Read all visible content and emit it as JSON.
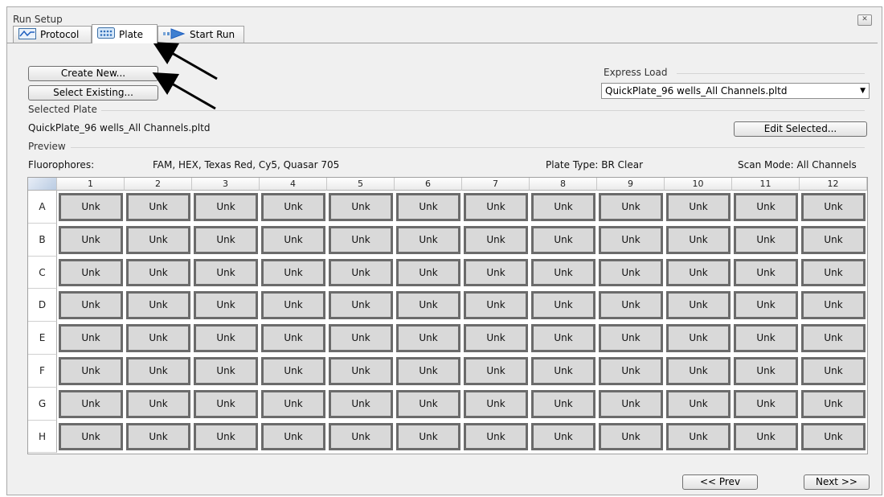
{
  "window": {
    "title": "Run Setup",
    "close_glyph": "✕"
  },
  "tabs": [
    {
      "label": "Protocol",
      "icon": "protocol-graph-icon"
    },
    {
      "label": "Plate",
      "icon": "plate-grid-icon"
    },
    {
      "label": "Start Run",
      "icon": "start-run-arrow-icon"
    }
  ],
  "buttons": {
    "create_new": "Create New...",
    "select_existing": "Select Existing...",
    "edit_selected": "Edit Selected...",
    "prev": "<< Prev",
    "next": "Next >>"
  },
  "express_load": {
    "label": "Express Load",
    "value": "QuickPlate_96 wells_All Channels.pltd"
  },
  "selected_plate": {
    "label": "Selected Plate",
    "file": "QuickPlate_96 wells_All Channels.pltd"
  },
  "preview": {
    "label": "Preview",
    "fluorophores_label": "Fluorophores:",
    "fluorophores_value": "FAM, HEX, Texas Red, Cy5, Quasar 705",
    "plate_type": "Plate Type: BR Clear",
    "scan_mode": "Scan Mode: All Channels"
  },
  "plate": {
    "columns": [
      "1",
      "2",
      "3",
      "4",
      "5",
      "6",
      "7",
      "8",
      "9",
      "10",
      "11",
      "12"
    ],
    "rows": [
      "A",
      "B",
      "C",
      "D",
      "E",
      "F",
      "G",
      "H"
    ],
    "well_label": "Unk"
  },
  "colors": {
    "accent": "#1e5fbf",
    "well_fill": "#d9d9d9",
    "well_border": "#6b6b6b"
  }
}
